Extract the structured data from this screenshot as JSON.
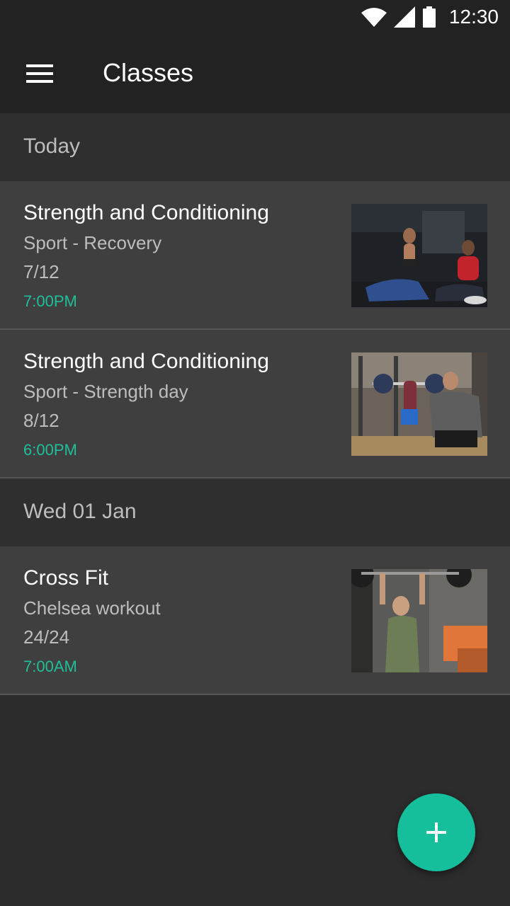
{
  "status_bar": {
    "time": "12:30",
    "icons": [
      "wifi-icon",
      "signal-icon",
      "battery-icon"
    ]
  },
  "app_bar": {
    "title": "Classes",
    "menu_icon": "hamburger-menu-icon"
  },
  "sections": [
    {
      "header": "Today",
      "classes": [
        {
          "title": "Strength and Conditioning",
          "subtitle": "Sport - Recovery",
          "count": "7/12",
          "time": "7:00PM",
          "image": "recovery-stretching-photo"
        },
        {
          "title": "Strength and Conditioning",
          "subtitle": "Sport - Strength day",
          "count": "8/12",
          "time": "6:00PM",
          "image": "strength-coach-photo"
        }
      ]
    },
    {
      "header": "Wed 01 Jan",
      "classes": [
        {
          "title": "Cross Fit",
          "subtitle": "Chelsea workout",
          "count": "24/24",
          "time": "7:00AM",
          "image": "crossfit-overhead-lift-photo"
        }
      ]
    }
  ],
  "fab": {
    "icon": "plus-icon"
  },
  "colors": {
    "accent": "#15bf9b",
    "time_text": "#1fbf9a",
    "app_bar": "#222222",
    "card_bg": "#3f3f3f",
    "section_bg": "#2f2f2f",
    "background": "#2c2c2c"
  }
}
